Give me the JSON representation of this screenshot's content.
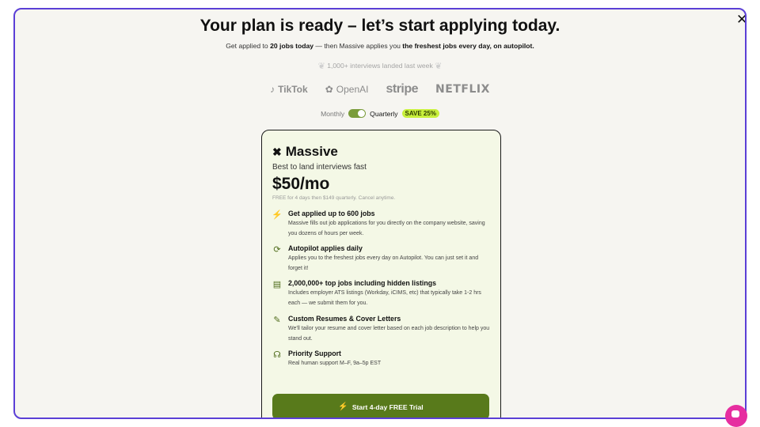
{
  "headline": "Your plan is ready – let’s start applying today.",
  "subline": {
    "part1": "Get applied to",
    "bold1": "20 jobs today",
    "part2": "— then Massive applies you",
    "bold2": "the freshest jobs every day, on autopilot."
  },
  "social_proof": "1,000+ interviews landed last week",
  "logos": {
    "tiktok": "TikTok",
    "openai": "OpenAI",
    "stripe": "stripe",
    "netflix": "NETFLIX"
  },
  "billing": {
    "monthly": "Monthly",
    "quarterly": "Quarterly",
    "save_badge": "SAVE 25%"
  },
  "plan": {
    "brand": "Massive",
    "tagline": "Best to land interviews fast",
    "price": "$50/mo",
    "price_note": "FREE for 4 days then $149 quarterly. Cancel anytime.",
    "features": [
      {
        "icon": "magic-wand-icon",
        "title": "Get applied up to 600 jobs",
        "desc": "Massive fills out job applications for you directly on the company website, saving you dozens of hours per week."
      },
      {
        "icon": "autopilot-icon",
        "title": "Autopilot applies daily",
        "desc": "Applies you to the freshest jobs every day on Autopilot. You can just set it and forget it!"
      },
      {
        "icon": "listings-icon",
        "title": "2,000,000+ top jobs including hidden listings",
        "desc": "Includes employer ATS listings (Workday, iCIMS, etc) that typically take 1-2 hrs each — we submit them for you."
      },
      {
        "icon": "resume-icon",
        "title": "Custom Resumes & Cover Letters",
        "desc": "We'll tailor your resume and cover letter based on each job description to help you stand out."
      },
      {
        "icon": "headset-icon",
        "title": "Priority Support",
        "desc": "Real human support M–F, 9a–5p EST"
      }
    ],
    "cta": "Start 4-day FREE Trial"
  },
  "colors": {
    "modal_border": "#5b3fd6",
    "accent_green": "#587a1b",
    "save_badge": "#c8f03c",
    "chat_bubble": "#e62ea0"
  }
}
